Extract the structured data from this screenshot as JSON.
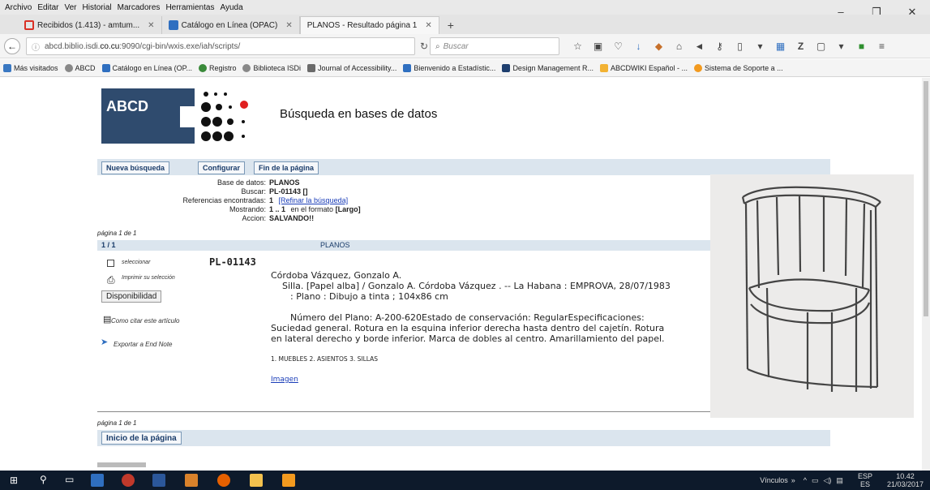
{
  "menu": [
    "Archivo",
    "Editar",
    "Ver",
    "Historial",
    "Marcadores",
    "Herramientas",
    "Ayuda"
  ],
  "window_controls": [
    "–",
    "❐",
    "✕"
  ],
  "tabs": [
    {
      "label": "Recibidos (1.413) - amtum...",
      "color": "#d93025",
      "active": false
    },
    {
      "label": "Catálogo en Línea (OPAC)",
      "color": "#2f6fc0",
      "active": false
    },
    {
      "label": "PLANOS - Resultado página 1",
      "color": "",
      "active": true
    }
  ],
  "tab_close": "✕",
  "new_tab": "+",
  "address": {
    "prefix": "abcd.biblio.isdi.",
    "host": "co.cu",
    "path": ":9090/cgi-bin/wxis.exe/iah/scripts/"
  },
  "search_placeholder": "Buscar",
  "bookmarks": [
    {
      "label": "Más visitados",
      "color": "#3a78c2"
    },
    {
      "label": "ABCD",
      "color": "#888888"
    },
    {
      "label": "Catálogo en Línea (OP...",
      "color": "#2f6fc0"
    },
    {
      "label": "Registro",
      "color": "#3a8a3a"
    },
    {
      "label": "Biblioteca ISDi",
      "color": "#888888"
    },
    {
      "label": "Journal of Accessibility...",
      "color": "#6a6a6a"
    },
    {
      "label": "Bienvenido a Estadístic...",
      "color": "#2f6fc0"
    },
    {
      "label": "Design Management R...",
      "color": "#1e3f6e"
    },
    {
      "label": "ABCDWIKI Español - ...",
      "color": "#f2b233"
    },
    {
      "label": "Sistema de Soporte a ...",
      "color": "#f29a1f"
    }
  ],
  "logo_text": "ABCD",
  "page_title": "Búsqueda en bases de datos",
  "buttons": {
    "new_search": "Nueva búsqueda",
    "configure": "Configurar",
    "page_end": "Fin de la página",
    "page_start": "Inicio de la página"
  },
  "meta": {
    "db_label": "Base de datos:",
    "db_value": "PLANOS",
    "search_label": "Buscar:",
    "search_value": "PL-01143 []",
    "refs_label": "Referencias encontradas:",
    "refs_value": "1",
    "refine": "[Refinar la búsqueda]",
    "show_label": "Mostrando:",
    "show_value": "1 .. 1",
    "show_format": "en el formato",
    "show_format_value": "[Largo]",
    "action_label": "Accion:",
    "action_value": "SALVANDO!!"
  },
  "page_info": "página 1 de 1",
  "result_header": {
    "count": "1 / 1",
    "db": "PLANOS"
  },
  "left_actions": {
    "select": "seleccionar",
    "print": "Imprimir su selección",
    "availability": "Disponibilidad",
    "cite": "Como citar este artículo",
    "export": "Exportar a End Note"
  },
  "record_id": "PL-01143",
  "record": {
    "author": "Córdoba Vázquez, Gonzalo A.",
    "title_line": "Silla. [Papel alba] / Gonzalo A. Córdoba Vázquez . -- La Habana : EMPROVA, 28/07/1983",
    "physical": ": Plano : Dibujo a tinta ; 104x86 cm",
    "notes": "Número del Plano: A-200-620Estado de conservación: RegularEspecificaciones: Suciedad general. Rotura en la esquina inferior derecha hasta dentro del cajetín. Rotura en lateral derecho y borde inferior. Marca de dobles al centro. Amarillamiento del papel.",
    "subjects": "1. MUEBLES 2. ASIENTOS 3. SILLAS",
    "image_link": "Imagen"
  },
  "taskbar": {
    "links": "Vínculos",
    "lang_top": "ESP",
    "lang_bottom": "ES",
    "time": "10.42",
    "date": "21/03/2017"
  }
}
